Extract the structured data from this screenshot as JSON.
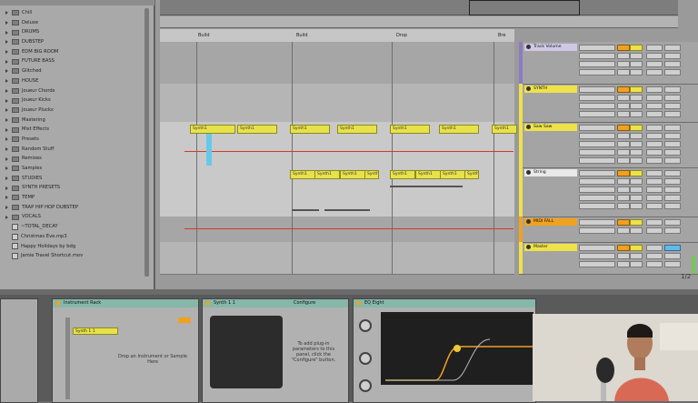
{
  "browser": {
    "items": [
      {
        "label": "Chill",
        "kind": "folder"
      },
      {
        "label": "Deluxe",
        "kind": "folder"
      },
      {
        "label": "DRUMS",
        "kind": "folder"
      },
      {
        "label": "DUBSTEP",
        "kind": "folder"
      },
      {
        "label": "EDM BIG ROOM",
        "kind": "folder"
      },
      {
        "label": "FUTURE BASS",
        "kind": "folder"
      },
      {
        "label": "Glitched",
        "kind": "folder"
      },
      {
        "label": "HOUSE",
        "kind": "folder"
      },
      {
        "label": "Joueur Chords",
        "kind": "folder"
      },
      {
        "label": "Joueur Kicks",
        "kind": "folder"
      },
      {
        "label": "Joueur Plucks",
        "kind": "folder"
      },
      {
        "label": "Mastering",
        "kind": "folder"
      },
      {
        "label": "Mist Effects",
        "kind": "folder"
      },
      {
        "label": "Presets",
        "kind": "folder"
      },
      {
        "label": "Random Stuff",
        "kind": "folder"
      },
      {
        "label": "Remixes",
        "kind": "folder"
      },
      {
        "label": "Samples",
        "kind": "folder"
      },
      {
        "label": "STUDIES",
        "kind": "folder"
      },
      {
        "label": "SYNTH PRESETS",
        "kind": "folder"
      },
      {
        "label": "TEMP",
        "kind": "folder"
      },
      {
        "label": "TRAP HIP HOP DUBSTEP",
        "kind": "folder"
      },
      {
        "label": "VOCALS",
        "kind": "folder"
      },
      {
        "label": "~TOTAL_DECAY",
        "kind": "file"
      },
      {
        "label": "Christmas Eve.mp3",
        "kind": "file"
      },
      {
        "label": "Happy Holidays by bdg",
        "kind": "file"
      },
      {
        "label": "Jamie Travel Shortcut.mov",
        "kind": "file"
      }
    ]
  },
  "arrangement": {
    "locators": [
      "Build",
      "Build",
      "Drop",
      "Bre"
    ],
    "clips_lane1": [
      "Synth1",
      "Synth1",
      "Synth1",
      "Synth1",
      "Synth1",
      "Synth1",
      "Synth1"
    ],
    "clips_lane2": [
      "Synth1",
      "Synth1",
      "Synth1",
      "Synth1",
      "Synth1",
      "Synth1",
      "Synth1",
      "Synth1"
    ],
    "page_indicator": "1/2"
  },
  "mixer": {
    "tracks": [
      {
        "name": "Track Volume",
        "color": "#8a7cc2"
      },
      {
        "name": "SYNTH",
        "color": "#eee14a"
      },
      {
        "name": "Saw Saw",
        "color": "#eee14a"
      },
      {
        "name": "String",
        "color": "#eee14a"
      },
      {
        "name": "MIDI FALL",
        "color": "#f0a11e"
      },
      {
        "name": "Master",
        "color": "#eee14a"
      }
    ]
  },
  "devices": {
    "rack_title": "Instrument Rack",
    "chain_label": "Synth 1 1",
    "drop_hint": "Drop an Instrument or Sample Here",
    "synth_title": "Synth 1 1",
    "configure_label": "Configure",
    "configure_hint": "To add plug-in parameters to this panel, click the \"Configure\" button.",
    "eq_title": "EQ Eight"
  },
  "colors": {
    "accent_yellow": "#eee14a",
    "accent_orange": "#f0a11e",
    "accent_blue": "#67b8e8",
    "automation": "#d43a2a"
  }
}
